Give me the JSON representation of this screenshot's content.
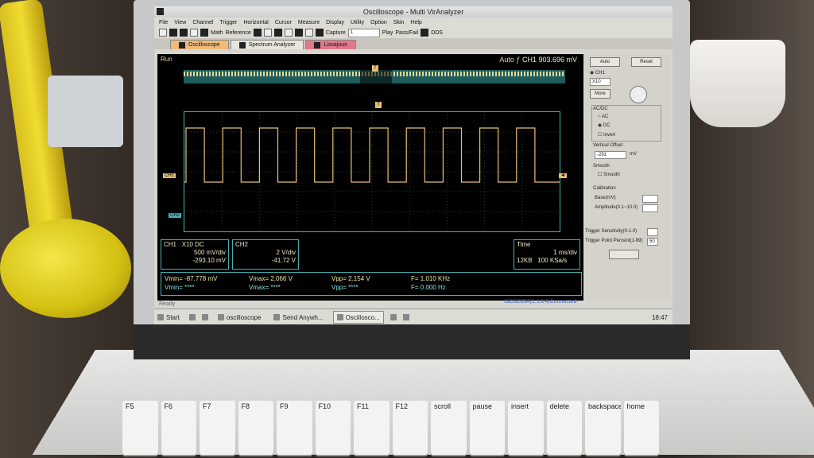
{
  "window": {
    "title": "Oscilloscope - Multi VirAnalyzer"
  },
  "menu": [
    "File",
    "View",
    "Channel",
    "Trigger",
    "Horizontal",
    "Cursor",
    "Measure",
    "Display",
    "Utility",
    "Option",
    "Skin",
    "Help"
  ],
  "toolbar": {
    "math": "Math",
    "reference": "Reference",
    "capture": "Capture",
    "capture_value": "1",
    "play": "Play",
    "passfail": "Pass/Fail",
    "dds": "DDS"
  },
  "tabs": [
    {
      "label": "Oscilloscope"
    },
    {
      "label": "Spectrum Analyzer"
    },
    {
      "label": "Lissajous"
    }
  ],
  "scope": {
    "run": "Run",
    "trigger_mode": "Auto",
    "trigger_level": "CH1 903.696 mV",
    "trigger_marker": "T",
    "ch1_marker": "CH1",
    "ch2_marker": "CH2",
    "ch1": {
      "name": "CH1",
      "probe": "X10",
      "coupling": "DC",
      "scale": "500 mV/div",
      "offset": "-293.10 mV"
    },
    "ch2": {
      "name": "CH2",
      "scale": "2 V/div",
      "offset": "-41.72 V"
    },
    "time": {
      "label": "Time",
      "scale": "1 ms/div",
      "depth": "12KB",
      "rate": "100 KSa/s"
    },
    "meas": {
      "ch1_vmin": "Vmin= -87.778 mV",
      "ch1_vmax": "Vmax= 2.066 V",
      "ch1_vpp": "Vpp= 2.154 V",
      "ch1_f": "F= 1.010 KHz",
      "ch2_vmin": "Vmin= ****",
      "ch2_vmax": "Vmax= ****",
      "ch2_vpp": "Vpp= ****",
      "ch2_f": "F= 0.000 Hz"
    },
    "waveform": {
      "periods": 10,
      "duty": 0.5
    }
  },
  "panel": {
    "auto": "Auto",
    "reset": "Reset",
    "ch1": "CH1",
    "ch_select": "X10",
    "more": "More",
    "acdc": "AC/DC",
    "ac": "AC",
    "dc": "DC",
    "invert": "Invert",
    "vertical_offset": "Vertical Offset",
    "offset_value": "-291",
    "offset_unit": "mV",
    "smooth_title": "Smooth",
    "smooth": "Smooth",
    "calibration": "Calibration",
    "base": "Base(mV)",
    "amplitude": "Amplitude(0.1~10.0)",
    "trig_sens": "Trigger Sensitivity(0-1.0)",
    "trig_point": "Trigger Point Percent(1-99)",
    "trig_point_value": "50"
  },
  "status": {
    "ready": "Ready",
    "device": "ISDS205A(1.1X/4)Connected"
  },
  "taskbar": {
    "start": "Start",
    "items": [
      {
        "label": "oscilloscope"
      },
      {
        "label": "Send Anywh..."
      },
      {
        "label": "Oscillosco..."
      }
    ],
    "clock": "18:47"
  },
  "keyboard": [
    "F5",
    "F6",
    "F7",
    "F8",
    "F9",
    "F10",
    "F11",
    "F12",
    "scroll",
    "pause",
    "insert",
    "delete",
    "backspace",
    "home"
  ],
  "colors": {
    "ch1": "#e8c070",
    "grid": "#48b0b0",
    "screen_bg": "#000000"
  }
}
